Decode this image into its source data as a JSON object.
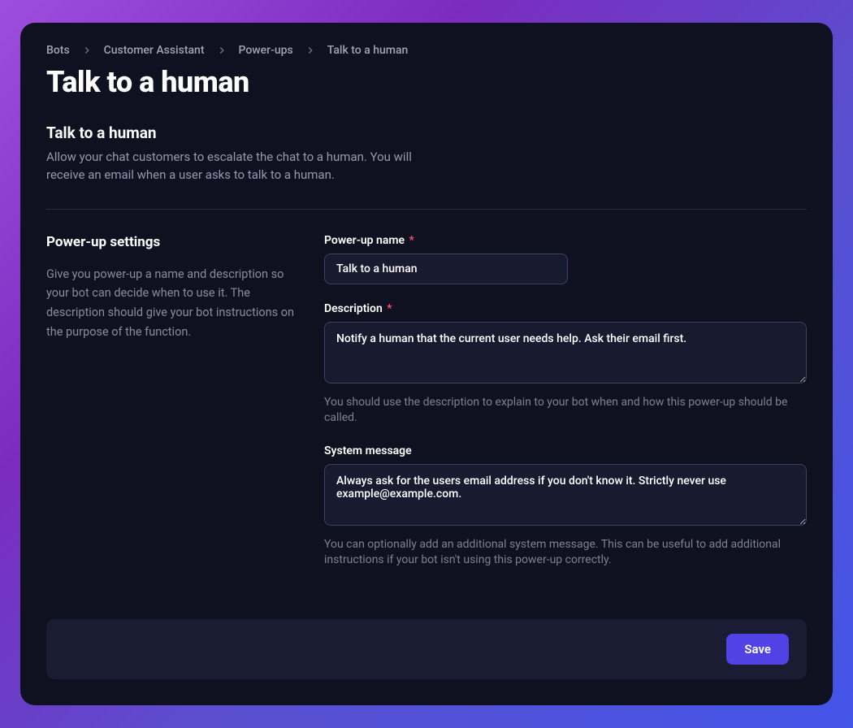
{
  "breadcrumb": {
    "items": [
      {
        "label": "Bots"
      },
      {
        "label": "Customer Assistant"
      },
      {
        "label": "Power-ups"
      },
      {
        "label": "Talk to a human"
      }
    ]
  },
  "page": {
    "title": "Talk to a human"
  },
  "intro": {
    "title": "Talk to a human",
    "desc": "Allow your chat customers to escalate the chat to a human. You will receive an email when a user asks to talk to a human."
  },
  "settings_side": {
    "title": "Power-up settings",
    "desc": "Give you power-up a name and description so your bot can decide when to use it. The description should give your bot instructions on the purpose of the function."
  },
  "fields": {
    "name": {
      "label": "Power-up name",
      "value": "Talk to a human"
    },
    "description": {
      "label": "Description",
      "value": "Notify a human that the current user needs help. Ask their email first.",
      "helper": "You should use the description to explain to your bot when and how this power-up should be called."
    },
    "system": {
      "label": "System message",
      "value": "Always ask for the users email address if you don't know it. Strictly never use example@example.com.",
      "helper": "You can optionally add an additional system message. This can be useful to add additional instructions if your bot isn't using this power-up correctly."
    }
  },
  "footer": {
    "save": "Save"
  }
}
